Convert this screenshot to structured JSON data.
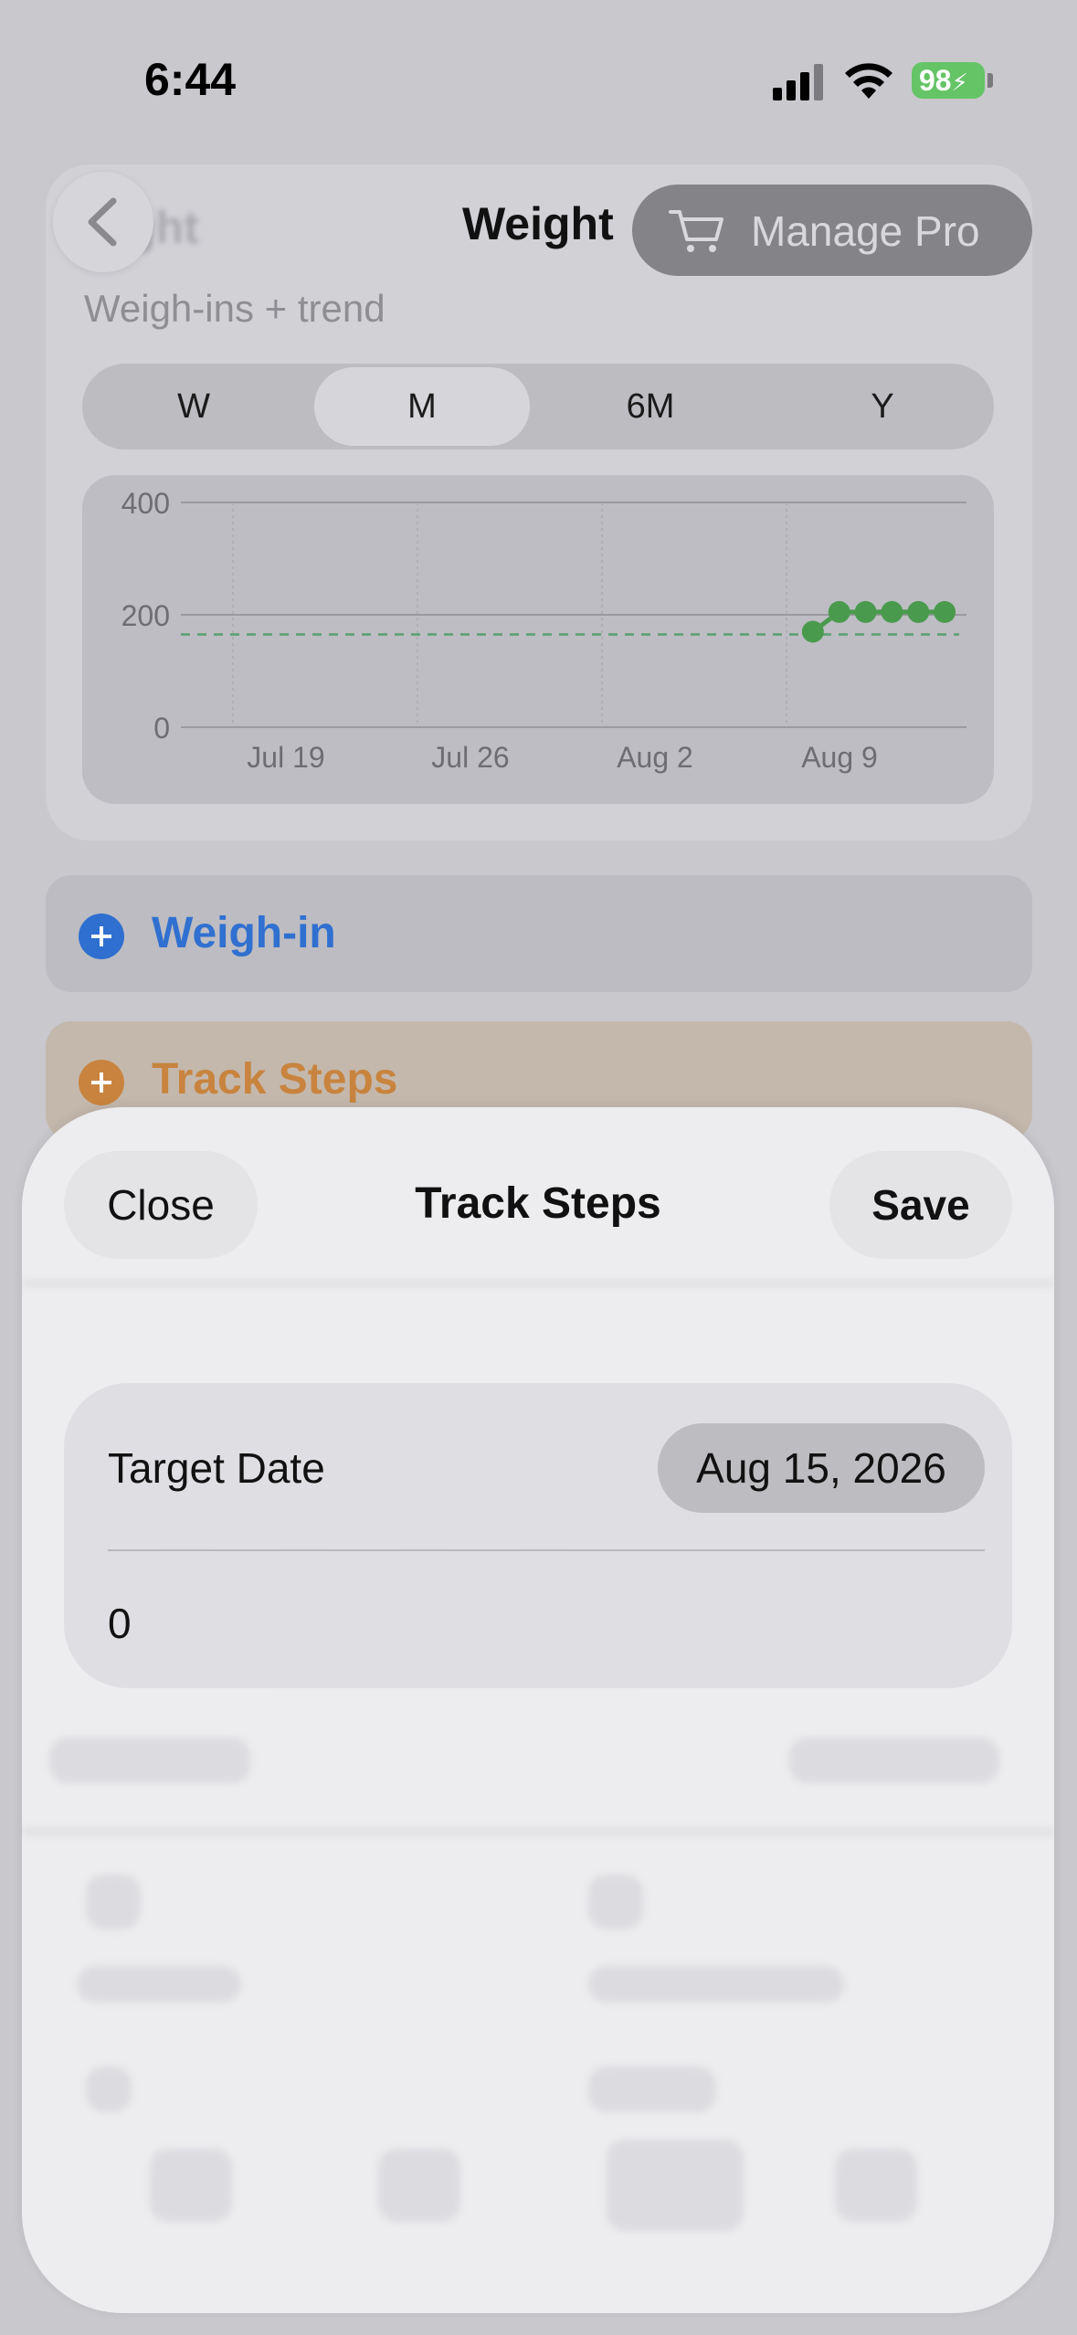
{
  "status_bar": {
    "time": "6:44",
    "battery": "98"
  },
  "nav": {
    "title": "Weight",
    "manage_pro": "Manage Pro"
  },
  "weight_card": {
    "title_partial": "ght",
    "subtitle": "Weigh-ins + trend",
    "segments": [
      "W",
      "M",
      "6M",
      "Y"
    ],
    "selected_segment": "M"
  },
  "chart_data": {
    "type": "line",
    "x": [
      "Jul 19",
      "Jul 26",
      "Aug 2",
      "Aug 9"
    ],
    "x_tick_labels": [
      "Jul 19",
      "Jul 26",
      "Aug 2",
      "Aug 9"
    ],
    "y_ticks": [
      "400",
      "200",
      "0"
    ],
    "ylim": [
      0,
      400
    ],
    "series": [
      {
        "values": [
          170,
          205,
          205,
          205,
          205,
          205
        ],
        "x_dates": [
          "Aug 10",
          "Aug 11",
          "Aug 12",
          "Aug 13",
          "Aug 14",
          "Aug 15"
        ],
        "color": "#4a9a4e"
      }
    ],
    "target_line": 165,
    "target_color": "#5aa070",
    "grid": true
  },
  "actions": {
    "weigh_in": "Weigh-in",
    "track_steps": "Track Steps"
  },
  "sheet": {
    "close": "Close",
    "title": "Track Steps",
    "save": "Save",
    "target_date_label": "Target Date",
    "target_date_value": "Aug 15, 2026",
    "steps_value": "0"
  },
  "colors": {
    "accent_blue": "#3070d0",
    "accent_orange": "#c8843e",
    "chart_green": "#4a9a4e",
    "battery_green": "#64c466"
  }
}
